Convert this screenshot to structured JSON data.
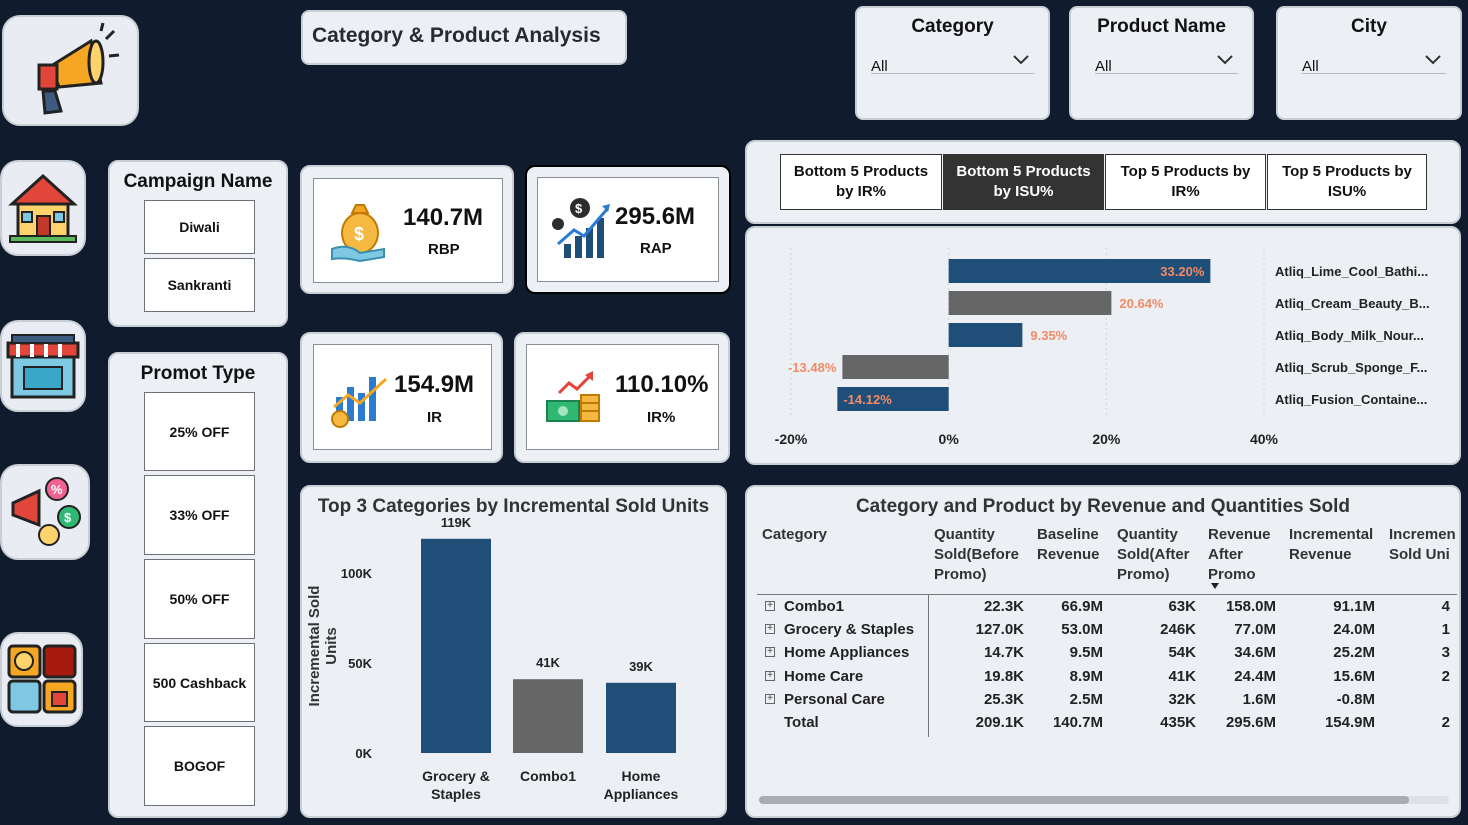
{
  "page_title": "Category & Product Analysis",
  "filters": [
    {
      "label": "Category",
      "value": "All"
    },
    {
      "label": "Product Name",
      "value": "All"
    },
    {
      "label": "City",
      "value": "All"
    }
  ],
  "campaign": {
    "title": "Campaign Name",
    "items": [
      "Diwali",
      "Sankranti"
    ]
  },
  "promo": {
    "title": "Promot Type",
    "items": [
      "25% OFF",
      "33% OFF",
      "50% OFF",
      "500 Cashback",
      "BOGOF"
    ]
  },
  "kpis": [
    {
      "value": "140.7M",
      "label": "RBP"
    },
    {
      "value": "295.6M",
      "label": "RAP"
    },
    {
      "value": "154.9M",
      "label": "IR"
    },
    {
      "value": "110.10%",
      "label": "IR%"
    }
  ],
  "tabs": [
    {
      "line1": "Bottom 5 Products",
      "line2": "by IR%"
    },
    {
      "line1": "Bottom 5 Products",
      "line2": "by ISU%"
    },
    {
      "line1": "Top 5 Products by",
      "line2": "IR%"
    },
    {
      "line1": "Top 5 Products by",
      "line2": "ISU%"
    }
  ],
  "chart_data": [
    {
      "type": "bar",
      "orientation": "horizontal",
      "categories": [
        "Atliq_Lime_Cool_Bathi...",
        "Atliq_Cream_Beauty_B...",
        "Atliq_Body_Milk_Nour...",
        "Atliq_Scrub_Sponge_F...",
        "Atliq_Fusion_Containe..."
      ],
      "values": [
        33.2,
        20.64,
        9.35,
        -13.48,
        -14.12
      ],
      "labels": [
        "33.20%",
        "20.64%",
        "9.35%",
        "-13.48%",
        "-14.12%"
      ],
      "colors": [
        "#1f4e79",
        "#666666",
        "#1f4e79",
        "#666666",
        "#1f4e79"
      ],
      "xticks": [
        "-20%",
        "0%",
        "20%",
        "40%"
      ],
      "xlim": [
        -20,
        40
      ]
    },
    {
      "type": "bar",
      "title": "Top 3 Categories by Incremental Sold Units",
      "categories": [
        [
          "Grocery &",
          "Staples"
        ],
        [
          "Combo1"
        ],
        [
          "Home",
          "Appliances"
        ]
      ],
      "values": [
        119,
        41,
        39
      ],
      "labels": [
        "119K",
        "41K",
        "39K"
      ],
      "colors": [
        "#1f4e79",
        "#666666",
        "#1f4e79"
      ],
      "ylabel": "Incremental Sold Units",
      "yticks": [
        "0K",
        "50K",
        "100K"
      ],
      "ylim": [
        0,
        120
      ]
    }
  ],
  "matrix": {
    "title": "Category and Product by Revenue and Quantities Sold",
    "headers": [
      [
        "Category"
      ],
      [
        "Quantity",
        "Sold(Before",
        "Promo)"
      ],
      [
        "Baseline",
        "Revenue"
      ],
      [
        "Quantity",
        "Sold(After",
        "Promo)"
      ],
      [
        "Revenue",
        "After",
        "Promo"
      ],
      [
        "Incremental",
        "Revenue"
      ],
      [
        "Incremen",
        "Sold Uni"
      ]
    ],
    "rows": [
      [
        "Combo1",
        "22.3K",
        "66.9M",
        "63K",
        "158.0M",
        "91.1M",
        "4"
      ],
      [
        "Grocery & Staples",
        "127.0K",
        "53.0M",
        "246K",
        "77.0M",
        "24.0M",
        "1"
      ],
      [
        "Home Appliances",
        "14.7K",
        "9.5M",
        "54K",
        "34.6M",
        "25.2M",
        "3"
      ],
      [
        "Home Care",
        "19.8K",
        "8.9M",
        "41K",
        "24.4M",
        "15.6M",
        "2"
      ],
      [
        "Personal Care",
        "25.3K",
        "2.5M",
        "32K",
        "1.6M",
        "-0.8M",
        ""
      ],
      [
        "Total",
        "209.1K",
        "140.7M",
        "435K",
        "295.6M",
        "154.9M",
        "2"
      ]
    ]
  }
}
